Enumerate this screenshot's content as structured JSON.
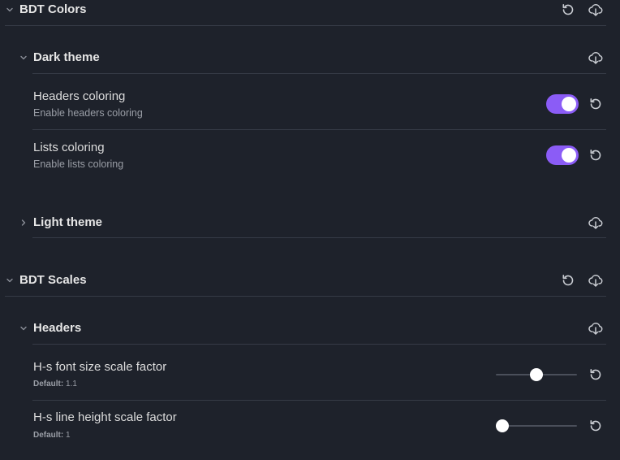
{
  "sections": [
    {
      "title": "BDT Colors",
      "groups": [
        {
          "title": "Dark theme",
          "settings": [
            {
              "name": "Headers coloring",
              "description": "Enable headers coloring",
              "enabled": true
            },
            {
              "name": "Lists coloring",
              "description": "Enable lists coloring",
              "enabled": true
            }
          ]
        },
        {
          "title": "Light theme"
        }
      ]
    },
    {
      "title": "BDT Scales",
      "groups": [
        {
          "title": "Headers",
          "settings": [
            {
              "name": "H-s font size scale factor",
              "default_label": "Default:",
              "default_value": "1.1",
              "slider_value": 0.5
            },
            {
              "name": "H-s line height scale factor",
              "default_label": "Default:",
              "default_value": "1",
              "slider_value": 0.08
            }
          ]
        }
      ]
    }
  ],
  "icons": {
    "chevron_down": "chevron-down-icon",
    "chevron_right": "chevron-right-icon",
    "reset": "reset-icon",
    "download": "cloud-download-icon"
  },
  "colors": {
    "background": "#1e222b",
    "accent": "#8b5cf6",
    "divider": "#363b46"
  }
}
